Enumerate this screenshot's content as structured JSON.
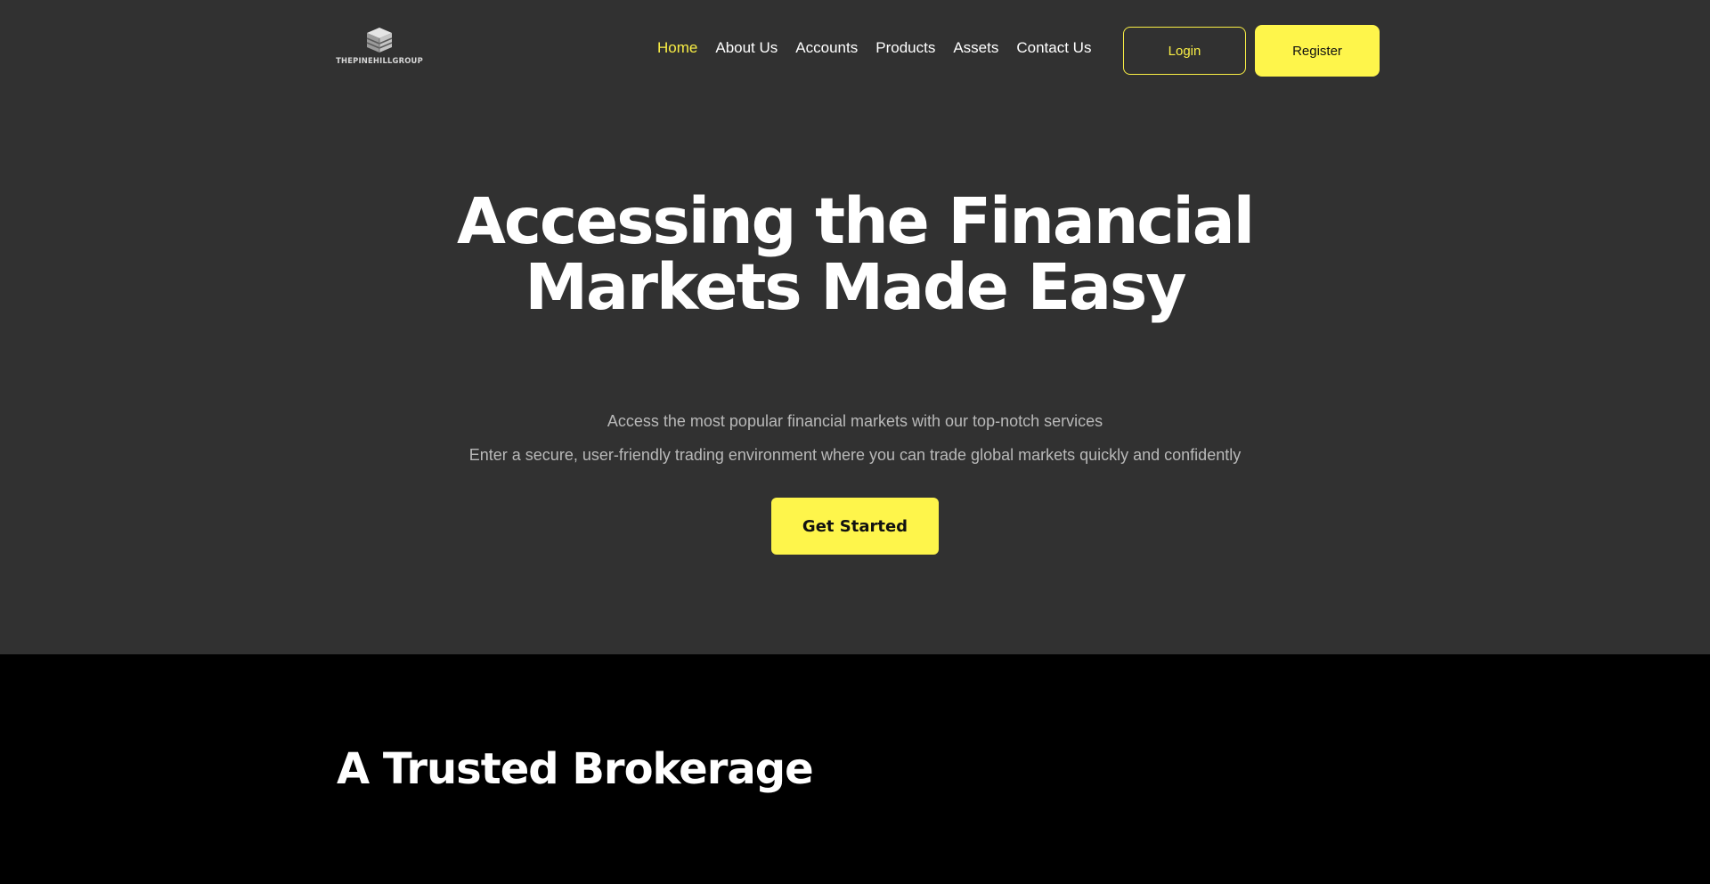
{
  "brand": {
    "logo_text": "THEPINEHILLGROUP",
    "accent_color": "#fef54b",
    "hero_bg": "#313131",
    "section_bg": "#000000"
  },
  "nav": {
    "items": [
      {
        "label": "Home",
        "active": true
      },
      {
        "label": "About Us"
      },
      {
        "label": "Accounts"
      },
      {
        "label": "Products"
      },
      {
        "label": "Assets"
      },
      {
        "label": "Contact Us"
      }
    ],
    "login_label": "Login",
    "register_label": "Register"
  },
  "hero": {
    "title_line1": "Accessing the Financial",
    "title_line2": "Markets Made Easy",
    "subtitle1": "Access the most popular financial markets with our top-notch services",
    "subtitle2": "Enter a secure, user-friendly trading environment where you can trade global markets quickly and confidently",
    "cta_label": "Get Started"
  },
  "section": {
    "title": "A Trusted Brokerage"
  }
}
